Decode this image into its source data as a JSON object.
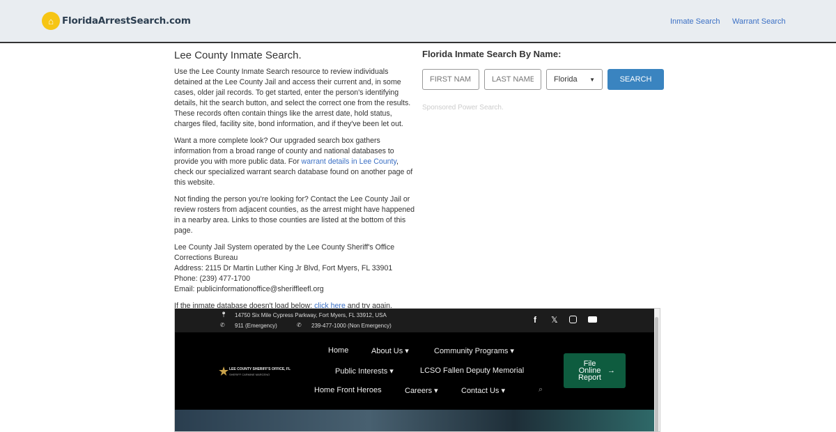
{
  "header": {
    "logo_text": "FloridaArrestSearch.com",
    "nav": [
      "Inmate Search",
      "Warrant Search"
    ]
  },
  "left": {
    "title": "Lee County Inmate Search.",
    "p1": "Use the Lee County Inmate Search resource to review individuals detained at the Lee County Jail and access their current and, in some cases, older jail records. To get started, enter the person's identifying details, hit the search button, and select the correct one from the results. These records often contain things like the arrest date, hold status, charges filed, facility site, bond information, and if they've been let out.",
    "p2_a": "Want a more complete look? Our upgraded search box gathers information from a broad range of county and national databases to provide you with more public data. For ",
    "p2_link": "warrant details in Lee County",
    "p2_b": ", check our specialized warrant search database found on another page of this website.",
    "p3": "Not finding the person you're looking for? Contact the Lee County Jail or review rosters from adjacent counties, as the arrest might have happened in a nearby area. Links to those counties are listed at the bottom of this page.",
    "info": [
      "Lee County Jail System operated by the Lee County Sheriff's Office Corrections Bureau",
      "Address: 2115 Dr Martin Luther King Jr Blvd, Fort Myers, FL 33901",
      "Phone: (239) 477-1700",
      "Email: publicinformationoffice@sheriffleefl.org"
    ],
    "p5_a": "If the inmate database doesn't load below: ",
    "p5_link": "click here",
    "p5_b": " and try again."
  },
  "search": {
    "title": "Florida Inmate Search By Name:",
    "first_placeholder": "FIRST NAME",
    "last_placeholder": "LAST NAME",
    "state": "Florida",
    "button": "SEARCH",
    "sponsored": "Sponsored Power Search."
  },
  "embed": {
    "address": "14750 Six Mile Cypress Parkway, Fort Myers, FL 33912, USA",
    "phone1": "911 (Emergency)",
    "phone2": "239-477-1000 (Non Emergency)",
    "logo_line1": "LEE COUNTY SHERIFF'S OFFICE, FL",
    "logo_line2": "SHERIFF CARMINE MARCENO",
    "menu": [
      "Home",
      "About Us",
      "Community Programs",
      "Public Interests",
      "LCSO Fallen Deputy Memorial",
      "Home Front Heroes",
      "Careers",
      "Contact Us"
    ],
    "report": "File Online Report"
  }
}
